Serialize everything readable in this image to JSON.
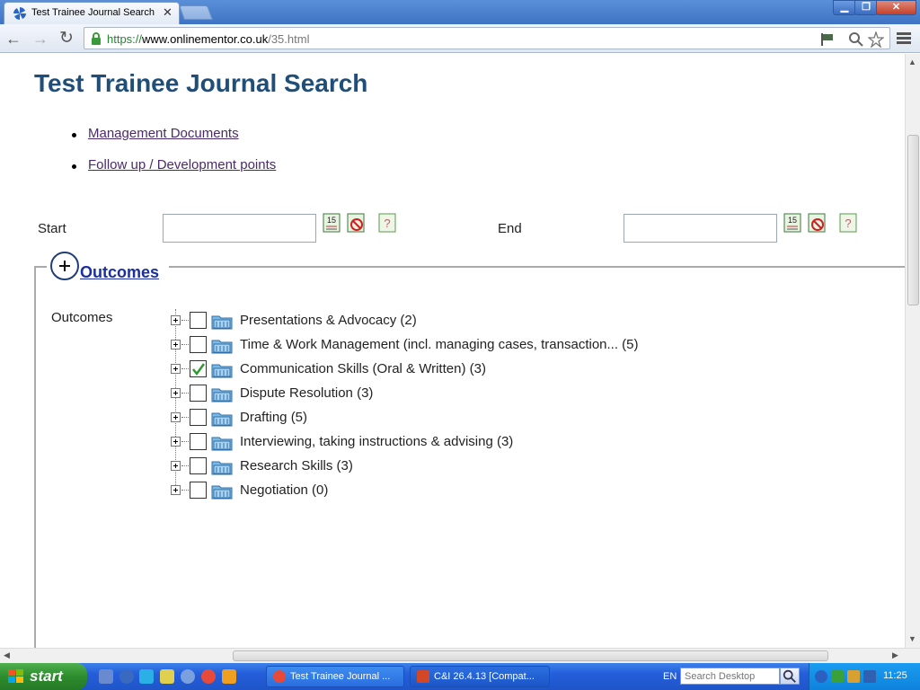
{
  "browser": {
    "tab_title": "Test Trainee Journal Search",
    "tab_close": "✕",
    "url_scheme": "https://",
    "url_host": "www.onlinementor.co.uk",
    "url_path": "/35.html",
    "window_min": "▁",
    "window_max": "❐",
    "window_close": "✕"
  },
  "page": {
    "title": "Test Trainee Journal Search",
    "links": [
      "Management Documents",
      "Follow up / Development points"
    ],
    "start_label": "Start",
    "end_label": "End",
    "start_value": "",
    "end_value": "",
    "calendar_day": "15",
    "help_mark": "?",
    "outcomes_legend": "Outcomes",
    "outcomes_label": "Outcomes",
    "outcomes": [
      {
        "label": "Presentations & Advocacy (2)",
        "checked": false
      },
      {
        "label": "Time & Work Management (incl. managing cases, transaction... (5)",
        "checked": false
      },
      {
        "label": "Communication Skills (Oral & Written) (3)",
        "checked": true
      },
      {
        "label": "Dispute Resolution (3)",
        "checked": false
      },
      {
        "label": "Drafting (5)",
        "checked": false
      },
      {
        "label": "Interviewing, taking instructions & advising (3)",
        "checked": false
      },
      {
        "label": "Research Skills (3)",
        "checked": false
      },
      {
        "label": "Negotiation (0)",
        "checked": false
      }
    ]
  },
  "taskbar": {
    "start_label": "start",
    "tasks": [
      "Test Trainee Journal ...",
      "C&I 26.4.13 [Compat..."
    ],
    "language": "EN",
    "search_placeholder": "Search Desktop",
    "clock": "11:25"
  },
  "colors": {
    "title": "#1f4e79",
    "legend_link": "#1a2fa0",
    "visited_link": "#4b2a6b",
    "check_green": "#2e9a2e"
  }
}
